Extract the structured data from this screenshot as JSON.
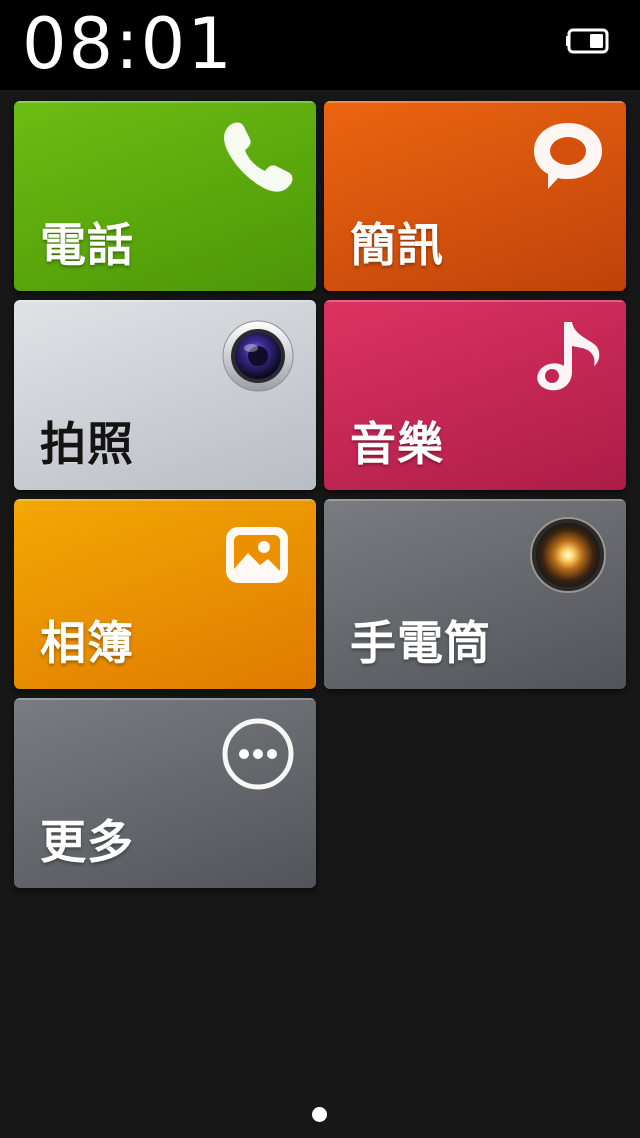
{
  "status_bar": {
    "time": "08:01",
    "battery_icon": "battery-icon"
  },
  "tiles": [
    {
      "label": "電話",
      "icon": "phone-icon",
      "color": "#5ea90e"
    },
    {
      "label": "簡訊",
      "icon": "chat-bubble-icon",
      "color": "#d8540c"
    },
    {
      "label": "拍照",
      "icon": "camera-lens-icon",
      "color": "#cfd2d7"
    },
    {
      "label": "音樂",
      "icon": "music-note-icon",
      "color": "#c62752"
    },
    {
      "label": "相簿",
      "icon": "gallery-image-icon",
      "color": "#eb9302"
    },
    {
      "label": "手電筒",
      "icon": "flashlight-icon",
      "color": "#66686e"
    },
    {
      "label": "更多",
      "icon": "more-icon",
      "color": "#66686e"
    }
  ],
  "pager": {
    "current_page": 1,
    "total_pages": 1
  }
}
